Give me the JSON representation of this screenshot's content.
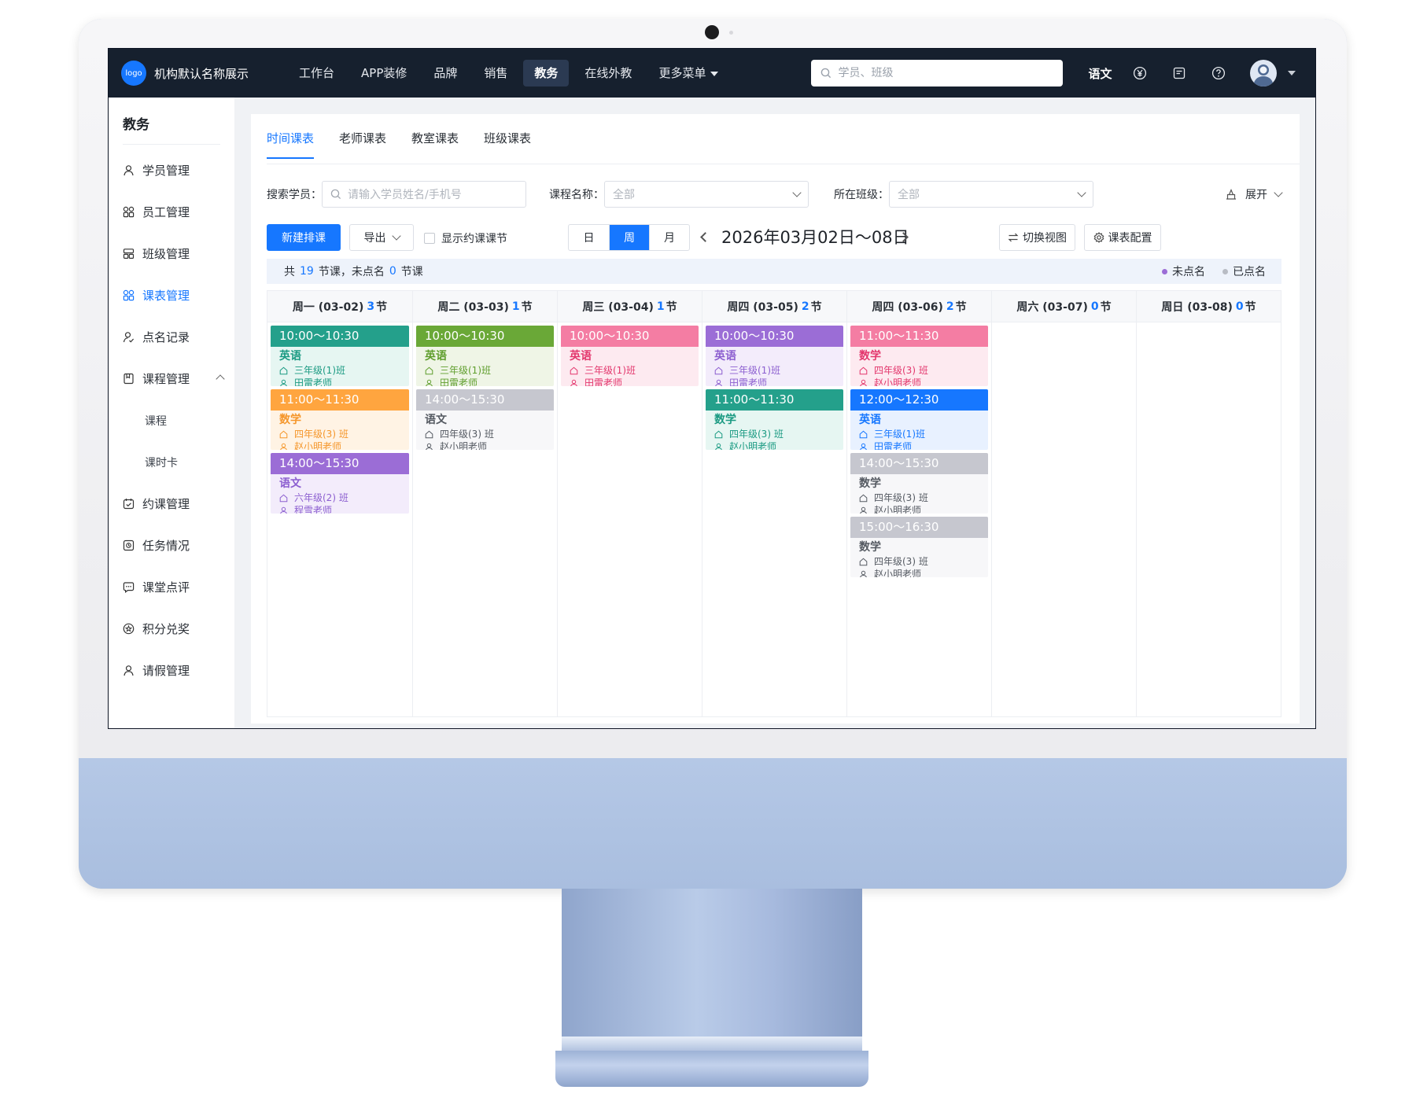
{
  "topbar": {
    "logo_text": "logo",
    "org_name": "机构默认名称展示",
    "nav": [
      {
        "label": "工作台",
        "active": false
      },
      {
        "label": "APP装修",
        "active": false
      },
      {
        "label": "品牌",
        "active": false
      },
      {
        "label": "销售",
        "active": false
      },
      {
        "label": "教务",
        "active": true
      },
      {
        "label": "在线外教",
        "active": false
      },
      {
        "label": "更多菜单",
        "active": false
      }
    ],
    "search_placeholder": "学员、班级",
    "subject": "语文",
    "icons": [
      "yen-icon",
      "note-icon",
      "help-icon",
      "avatar",
      "chevron-down-icon"
    ]
  },
  "sidebar": {
    "title": "教务",
    "items": [
      {
        "label": "学员管理",
        "icon": "user-icon"
      },
      {
        "label": "员工管理",
        "icon": "grid-icon"
      },
      {
        "label": "班级管理",
        "icon": "class-icon"
      },
      {
        "label": "课表管理",
        "icon": "grid-icon",
        "active": true
      },
      {
        "label": "点名记录",
        "icon": "user-check-icon"
      },
      {
        "label": "课程管理",
        "icon": "book-icon",
        "expanded": true
      },
      {
        "label": "课程",
        "sub": true
      },
      {
        "label": "课时卡",
        "sub": true
      },
      {
        "label": "约课管理",
        "icon": "calendar-check-icon"
      },
      {
        "label": "任务情况",
        "icon": "task-icon"
      },
      {
        "label": "课堂点评",
        "icon": "comment-icon"
      },
      {
        "label": "积分兑奖",
        "icon": "star-icon"
      },
      {
        "label": "请假管理",
        "icon": "user-icon"
      }
    ]
  },
  "tabs": [
    {
      "label": "时间课表",
      "active": true
    },
    {
      "label": "老师课表",
      "active": false
    },
    {
      "label": "教室课表",
      "active": false
    },
    {
      "label": "班级课表",
      "active": false
    }
  ],
  "filters": {
    "student_label": "搜索学员：",
    "student_placeholder": "请输入学员姓名/手机号",
    "course_label": "课程名称：",
    "course_value": "全部",
    "class_label": "所在班级：",
    "class_value": "全部",
    "expand_label": "展开"
  },
  "actions": {
    "new_label": "新建排课",
    "export_label": "导出",
    "show_booking_label": "显示约课课节",
    "view_modes": [
      {
        "label": "日",
        "active": false
      },
      {
        "label": "周",
        "active": true
      },
      {
        "label": "月",
        "active": false
      }
    ],
    "date_range": "2026年03月02日～08日",
    "switch_view_label": "切换视图",
    "config_label": "课表配置"
  },
  "summary": {
    "prefix": "共",
    "total": "19",
    "mid": "节课，未点名",
    "unmarked": "0",
    "suffix": "节课",
    "legend": [
      {
        "label": "未点名",
        "color": "#9b6dd6"
      },
      {
        "label": "已点名",
        "color": "#b8bcc4"
      }
    ]
  },
  "schedule": [
    {
      "day": "周一 (03-02)",
      "count": "3",
      "unit": "节",
      "lessons": [
        {
          "time": "10:00～10:30",
          "subject": "英语",
          "class": "三年级(1)班",
          "teacher": "田雷老师",
          "header_color": "#24a08b",
          "body_color": "#e6f6f2",
          "text_color": "#1a9a82"
        },
        {
          "time": "11:00～11:30",
          "subject": "数学",
          "class": "四年级(3) 班",
          "teacher": "赵小明老师",
          "header_color": "#ffa53f",
          "body_color": "#fff3e4",
          "text_color": "#f5962a"
        },
        {
          "time": "14:00～15:30",
          "subject": "语文",
          "class": "六年级(2) 班",
          "teacher": "程雪老师",
          "header_color": "#9b6dd6",
          "body_color": "#f3ecfb",
          "text_color": "#8c5fd0"
        }
      ]
    },
    {
      "day": "周二 (03-03)",
      "count": "1",
      "unit": "节",
      "lessons": [
        {
          "time": "10:00～10:30",
          "subject": "英语",
          "class": "三年级(1)班",
          "teacher": "田雷老师",
          "header_color": "#6aa837",
          "body_color": "#eff5e6",
          "text_color": "#5f9e2d"
        },
        {
          "time": "14:00～15:30",
          "subject": "语文",
          "class": "四年级(3) 班",
          "teacher": "赵小明老师",
          "header_color": "#c6c7cf",
          "body_color": "#f7f7f9",
          "text_color": "#555a62"
        }
      ]
    },
    {
      "day": "周三 (03-04)",
      "count": "1",
      "unit": "节",
      "lessons": [
        {
          "time": "10:00～10:30",
          "subject": "英语",
          "class": "三年级(1)班",
          "teacher": "田雷老师",
          "header_color": "#f47da3",
          "body_color": "#fdeaf0",
          "text_color": "#e3376d"
        }
      ]
    },
    {
      "day": "周四 (03-05)",
      "count": "2",
      "unit": "节",
      "lessons": [
        {
          "time": "10:00～10:30",
          "subject": "英语",
          "class": "三年级(1)班",
          "teacher": "田雷老师",
          "header_color": "#9b6dd6",
          "body_color": "#f3ecfb",
          "text_color": "#8c5fd0"
        },
        {
          "time": "11:00～11:30",
          "subject": "数学",
          "class": "四年级(3) 班",
          "teacher": "赵小明老师",
          "header_color": "#24a08b",
          "body_color": "#e6f6f2",
          "text_color": "#1a9a82"
        }
      ]
    },
    {
      "day": "周四 (03-06)",
      "count": "2",
      "unit": "节",
      "lessons": [
        {
          "time": "11:00～11:30",
          "subject": "数学",
          "class": "四年级(3) 班",
          "teacher": "赵小明老师",
          "header_color": "#f47da3",
          "body_color": "#fdeaf0",
          "text_color": "#e3376d"
        },
        {
          "time": "12:00～12:30",
          "subject": "英语",
          "class": "三年级(1)班",
          "teacher": "田雷老师",
          "header_color": "#1677ff",
          "body_color": "#e8f1ff",
          "text_color": "#1677ff"
        },
        {
          "time": "14:00～15:30",
          "subject": "数学",
          "class": "四年级(3) 班",
          "teacher": "赵小明老师",
          "header_color": "#c6c7cf",
          "body_color": "#f7f7f9",
          "text_color": "#555a62"
        },
        {
          "time": "15:00～16:30",
          "subject": "数学",
          "class": "四年级(3) 班",
          "teacher": "赵小明老师",
          "header_color": "#c6c7cf",
          "body_color": "#f7f7f9",
          "text_color": "#555a62"
        }
      ]
    },
    {
      "day": "周六 (03-07)",
      "count": "0",
      "unit": "节",
      "lessons": []
    },
    {
      "day": "周日 (03-08)",
      "count": "0",
      "unit": "节",
      "lessons": []
    }
  ]
}
